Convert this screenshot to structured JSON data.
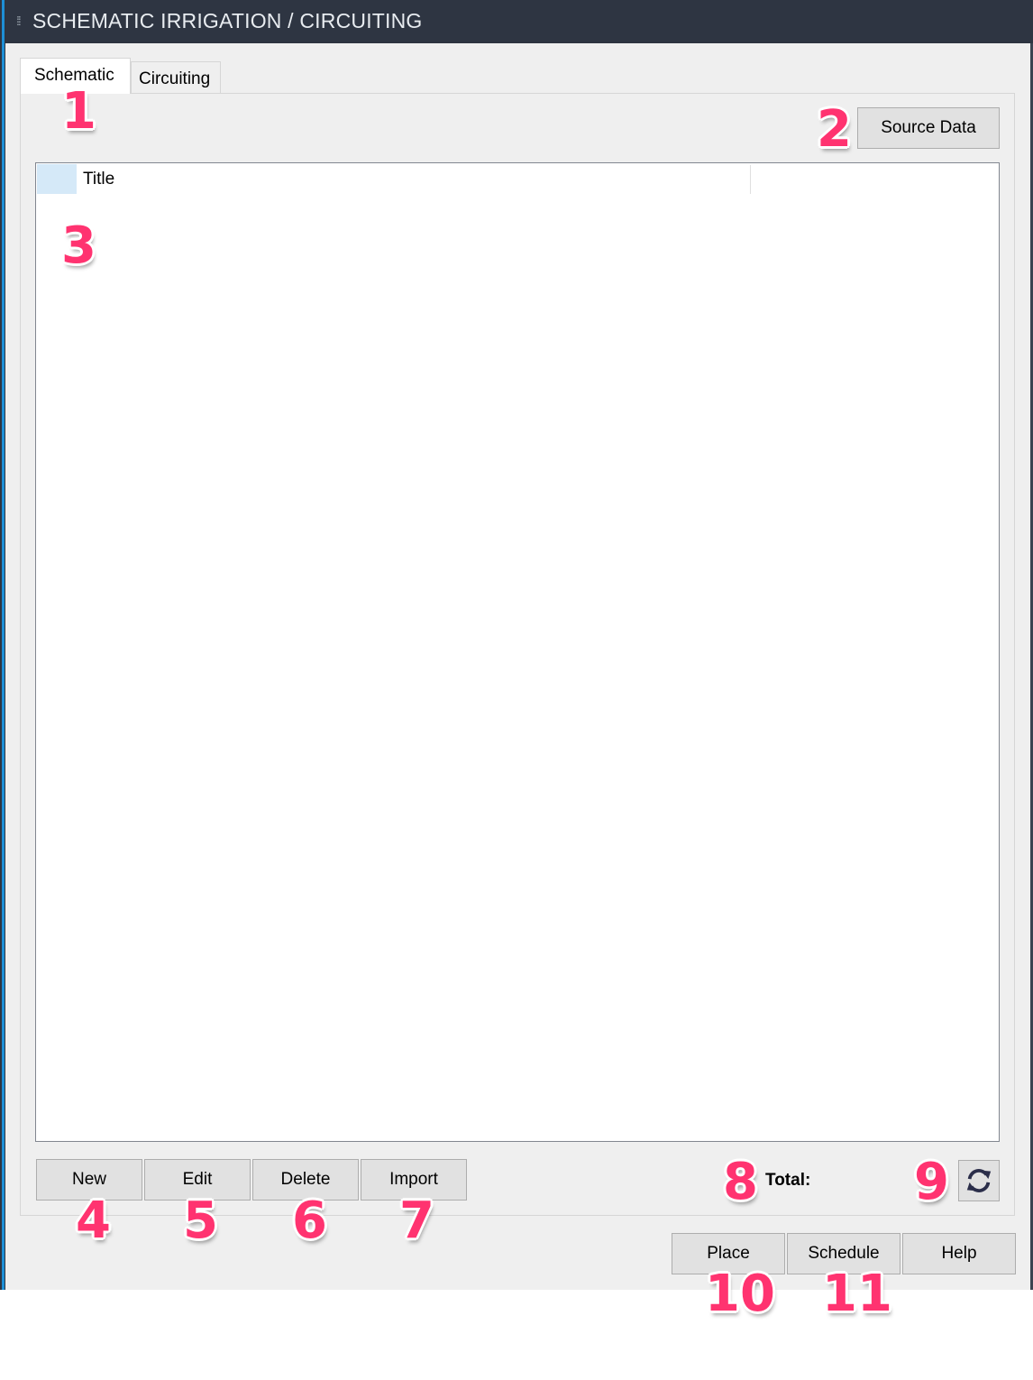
{
  "window": {
    "title": "SCHEMATIC IRRIGATION / CIRCUITING",
    "grip_icon": "drag-grip-icon"
  },
  "tabs": [
    {
      "label": "Schematic",
      "active": true
    },
    {
      "label": "Circuiting",
      "active": false
    }
  ],
  "schematic": {
    "source_data_label": "Source Data",
    "grid": {
      "columns": [
        "Title"
      ],
      "rows": []
    },
    "actions": {
      "new": "New",
      "edit": "Edit",
      "delete": "Delete",
      "import": "Import"
    },
    "total_label": "Total:",
    "total_value": "",
    "refresh_icon": "refresh-icon"
  },
  "footer": {
    "place": "Place",
    "schedule": "Schedule",
    "help": "Help"
  },
  "annotations": [
    "1",
    "2",
    "3",
    "4",
    "5",
    "6",
    "7",
    "8",
    "9",
    "10",
    "11"
  ],
  "colors": {
    "titlebar": "#2e3542",
    "accent_edge": "#1e8fd6",
    "badge": "#ff3370",
    "row_header": "#d5e9f8",
    "refresh_icon": "#2b2e4a"
  }
}
